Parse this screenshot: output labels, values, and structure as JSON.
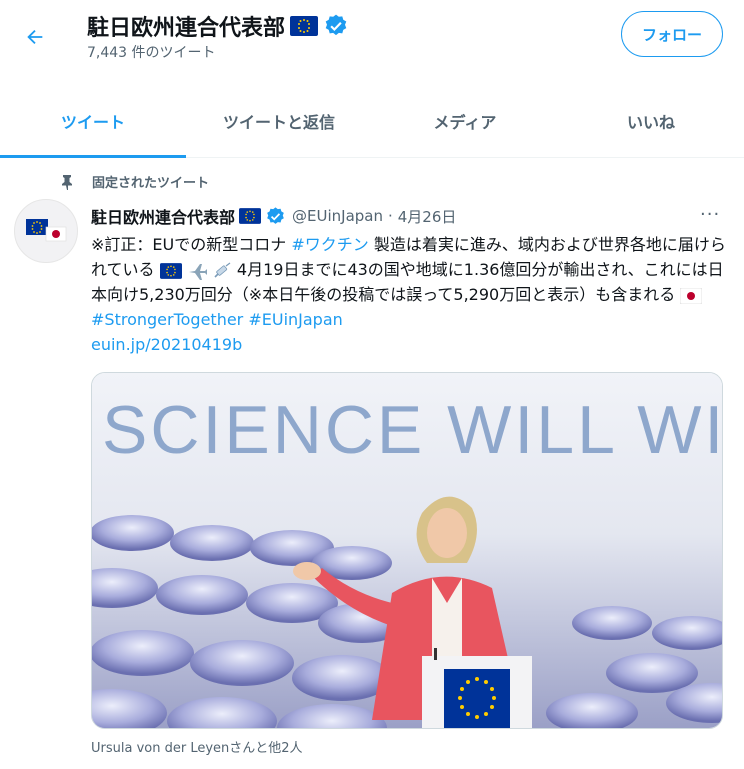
{
  "header": {
    "title": "駐日欧州連合代表部",
    "tweet_count": "7,443 件のツイート",
    "follow_label": "フォロー",
    "back_icon": "arrow-left-icon"
  },
  "tabs": [
    {
      "label": "ツイート",
      "active": true
    },
    {
      "label": "ツイートと返信",
      "active": false
    },
    {
      "label": "メディア",
      "active": false
    },
    {
      "label": "いいね",
      "active": false
    }
  ],
  "pinned_label": "固定されたツイート",
  "tweet": {
    "name": "駐日欧州連合代表部",
    "handle": "@EUinJapan",
    "separator": "·",
    "date": "4月26日",
    "more_label": "···",
    "text_1": "※訂正：EUでの新型コロナ ",
    "hashtag_vaccine": "#ワクチン",
    "text_2": " 製造は着実に進み、域内および世界各地に届けられている",
    "text_3": " 4月19日までに43の国や地域に1.36億回分が輸出され、これには日本向け5,230万回分（※本日午後の投稿では誤って5,290万回と表示）も含まれる ",
    "hashtag_1": "#StrongerTogether",
    "hashtag_2": "#EUinJapan",
    "link": "euin.jp/20210419b",
    "media_banner_text": "SCIENCE WILL WIN",
    "caption": "Ursula von der Leyenさんと他2人"
  },
  "colors": {
    "accent": "#1d9bf0",
    "secondary_text": "#536471",
    "eu_blue": "#003399",
    "eu_yellow": "#ffcc00",
    "jacket_pink": "#e8555f"
  }
}
